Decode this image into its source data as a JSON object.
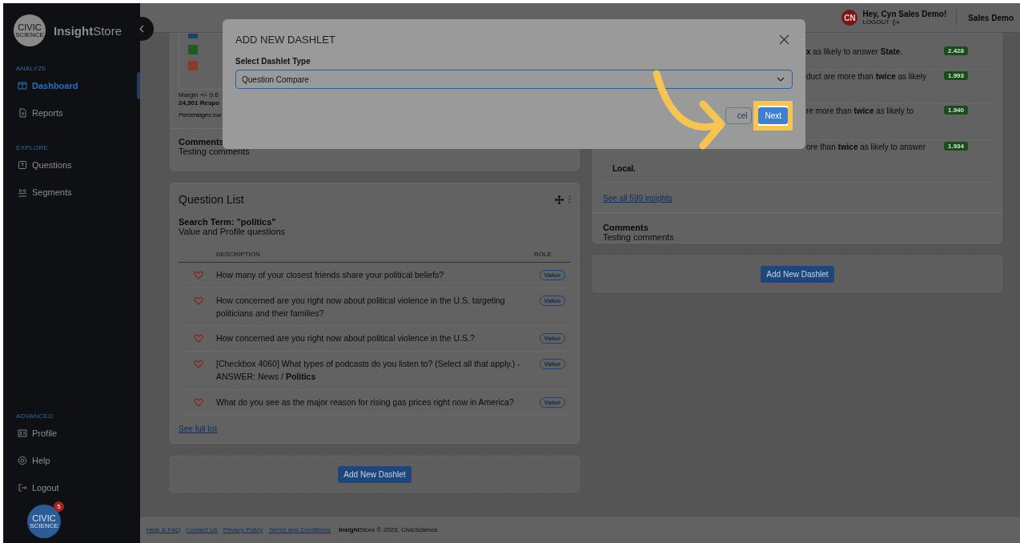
{
  "sidebar": {
    "logo_lines": [
      "CIVIC",
      "SCIENCE"
    ],
    "brand": "**Insight**Store",
    "sections": [
      {
        "label": "ANALYZE",
        "items": [
          {
            "label": "Dashboard",
            "selected": true
          },
          {
            "label": "Reports",
            "selected": false
          }
        ]
      },
      {
        "label": "EXPLORE",
        "items": [
          {
            "label": "Questions",
            "selected": false
          },
          {
            "label": "Segments",
            "selected": false
          }
        ]
      },
      {
        "label": "ADVANCED",
        "items": [
          {
            "label": "Profile",
            "selected": false
          },
          {
            "label": "Help",
            "selected": false
          },
          {
            "label": "Logout",
            "selected": false
          }
        ]
      }
    ],
    "chat_bubble": {
      "lines": [
        "CIVIC",
        "SCIENCE"
      ],
      "badge": "5"
    }
  },
  "header": {
    "avatar": "CN",
    "greeting": "Hey, Cyn Sales Demo!",
    "logout": "LOGOUT",
    "account": "Sales Demo"
  },
  "chart_card": {
    "legend": [
      {
        "color": "#1d3f73"
      },
      {
        "color": "#1f5a1f"
      },
      {
        "color": "#8a3a2a"
      }
    ],
    "margin": "Margin +/- 0.6",
    "responses": "24,301 Respo",
    "note": "Percentages ma",
    "comments_label": "Comments",
    "comments": "Testing comments"
  },
  "question_list": {
    "title": "Question List",
    "search_term": "Search Term: \"politics\"",
    "subtitle": "Value and Profile questions",
    "columns": [
      "DESCRIPTION",
      "ROLE"
    ],
    "rows": [
      {
        "description": "How many of your closest friends share your political beliefs?",
        "role": "Value"
      },
      {
        "description": "How concerned are you right now about political violence in the U.S. targeting politicians and their families?",
        "role": "Value"
      },
      {
        "description": "How concerned are you right now about political violence in the U.S.?",
        "role": "Value"
      },
      {
        "description": "[Checkbox 4060] What types of podcasts do you listen to? (Select all that apply.) - ANSWER: News / **Politics**",
        "role": "Value"
      },
      {
        "description": "What do you see as the major reason for rising gas prices right now in America?",
        "role": "Value"
      }
    ],
    "see_full": "See full list"
  },
  "add_dashlet_left": "Add New Dashlet",
  "insights_card": {
    "rows": [
      {
        "text": "**x** as likely to answer **State**.",
        "score": "2.428"
      },
      {
        "text": "duct are more than **twice** as likely",
        "score": "1.993"
      },
      {
        "text": "re more than **twice** as likely to",
        "score": "1.940"
      },
      {
        "text": "ore than **twice** as likely to answer",
        "continuation": "Local.",
        "score": "1.934"
      }
    ],
    "see_all": "See all 599 insights",
    "comments_label": "Comments",
    "comments": "Testing comments"
  },
  "add_dashlet_right": "Add New Dashlet",
  "footer": {
    "links": [
      "Help & FAQ",
      "Contact Us",
      "Privacy Policy",
      "Terms and Conditions"
    ],
    "copyright": "**Insight**Store © 2023, CivicScience"
  },
  "modal": {
    "title": "ADD NEW DASHLET",
    "field_label": "Select Dashlet Type",
    "value": "Question Compare",
    "cancel": "cel",
    "next": "Next"
  }
}
